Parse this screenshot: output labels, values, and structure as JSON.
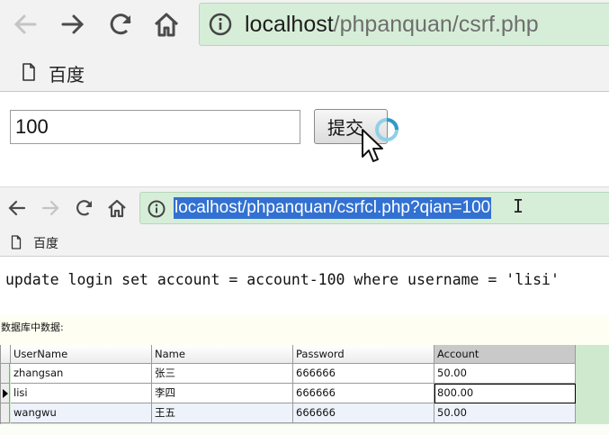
{
  "top_browser": {
    "url_host": "localhost",
    "url_path": "/phpanquan/csrf.php",
    "bookmark_label": "百度"
  },
  "form": {
    "amount_value": "100",
    "submit_label": "提交"
  },
  "second_browser": {
    "url": "localhost/phpanquan/csrfcl.php?qian=100",
    "bookmark_label": "百度"
  },
  "sql_output": "update login set account = account-100 where username = 'lisi'",
  "db_caption": "数据库中数据:",
  "grid": {
    "columns": [
      "UserName",
      "Name",
      "Password",
      "Account"
    ],
    "rows": [
      [
        "zhangsan",
        "张三",
        "666666",
        "50.00"
      ],
      [
        "lisi",
        "李四",
        "666666",
        "800.00"
      ],
      [
        "wangwu",
        "王五",
        "666666",
        "50.00"
      ]
    ],
    "current_row": 1
  },
  "icons": {
    "back": "arrow-left-icon",
    "forward": "arrow-right-icon",
    "reload": "reload-icon",
    "home": "home-icon",
    "info": "info-icon",
    "bookmark": "page-icon",
    "cursor": "mouse-pointer-icon",
    "text_cursor": "i-beam-icon"
  },
  "colors": {
    "omnibox_bg": "#d6eed8",
    "selection": "#3271d2",
    "grid_bg": "#cfe9cf"
  }
}
